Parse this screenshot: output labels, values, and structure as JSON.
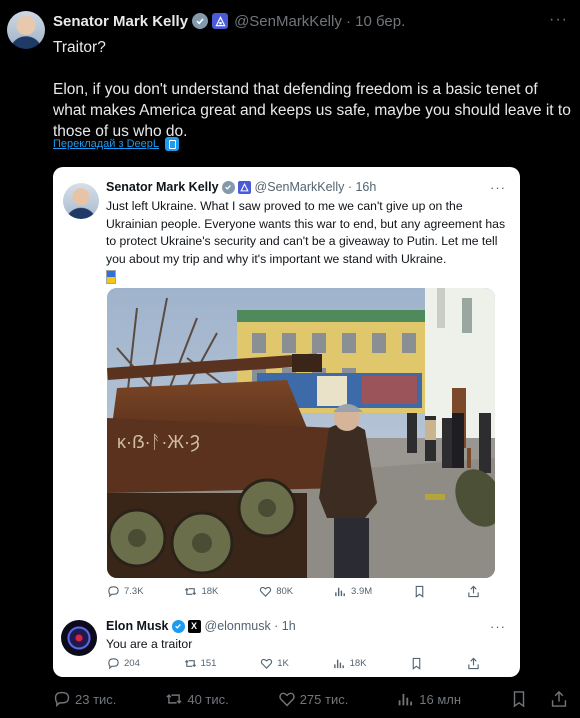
{
  "tweet": {
    "author_name": "Senator Mark Kelly",
    "handle_date": "@SenMarkKelly · 10 бер.",
    "paragraphs": [
      "Traitor?",
      "Elon, if you don't understand that defending freedom is a basic tenet of what makes America great and keeps us safe, maybe you should leave it to those of us who do."
    ],
    "translate_link": "Перекладай з DeepL",
    "stats": {
      "replies": "23 тис.",
      "reposts": "40 тис.",
      "likes": "275 тис.",
      "views": "16 млн"
    }
  },
  "screenshot": {
    "quoted": {
      "author_name": "Senator Mark Kelly",
      "handle_time": "@SenMarkKelly · 16h",
      "text": "Just left Ukraine. What I saw proved to me we can't give up on the Ukrainian people. Everyone wants this war to end, but any agreement has to protect Ukraine's security and can't be a giveaway to Putin. Let me tell you about my trip and why it's important we stand with Ukraine.",
      "stats": {
        "replies": "7.3K",
        "reposts": "18K",
        "likes": "80K",
        "views": "3.9M"
      }
    },
    "reply": {
      "author_name": "Elon Musk",
      "handle_time": "@elonmusk · 1h",
      "text": "You are a traitor",
      "stats": {
        "replies": "204",
        "reposts": "151",
        "likes": "1K",
        "views": "18K"
      }
    }
  },
  "icons": {
    "verified": "verified-badge-icon",
    "government": "government-badge-icon",
    "reply": "reply-icon",
    "repost": "repost-icon",
    "like": "heart-icon",
    "views": "views-chart-icon",
    "bookmark": "bookmark-icon",
    "share": "share-icon",
    "more": "more-icon"
  },
  "colors": {
    "background": "#000000",
    "accent": "#1d9bf0",
    "muted": "#71767b",
    "card": "#ffffff"
  }
}
